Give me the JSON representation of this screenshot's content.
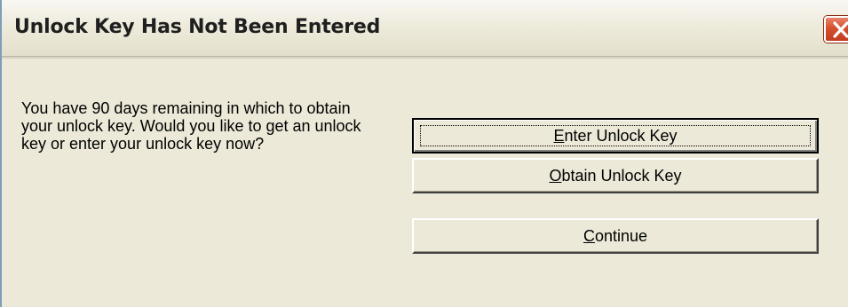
{
  "window": {
    "title": "Unlock Key Has Not Been Entered"
  },
  "message": {
    "text": "You have  90 days remaining in which to obtain your unlock key.  Would you like to get an unlock key or enter your unlock key now?"
  },
  "buttons": {
    "enter": {
      "mnemonic": "E",
      "rest": "nter Unlock Key"
    },
    "obtain": {
      "mnemonic": "O",
      "rest": "btain Unlock Key"
    },
    "continue": {
      "mnemonic": "C",
      "rest": "ontinue"
    }
  },
  "icons": {
    "close": "close-icon"
  },
  "colors": {
    "dialog_background": "#ece9d8",
    "close_button": "#d5502f"
  }
}
